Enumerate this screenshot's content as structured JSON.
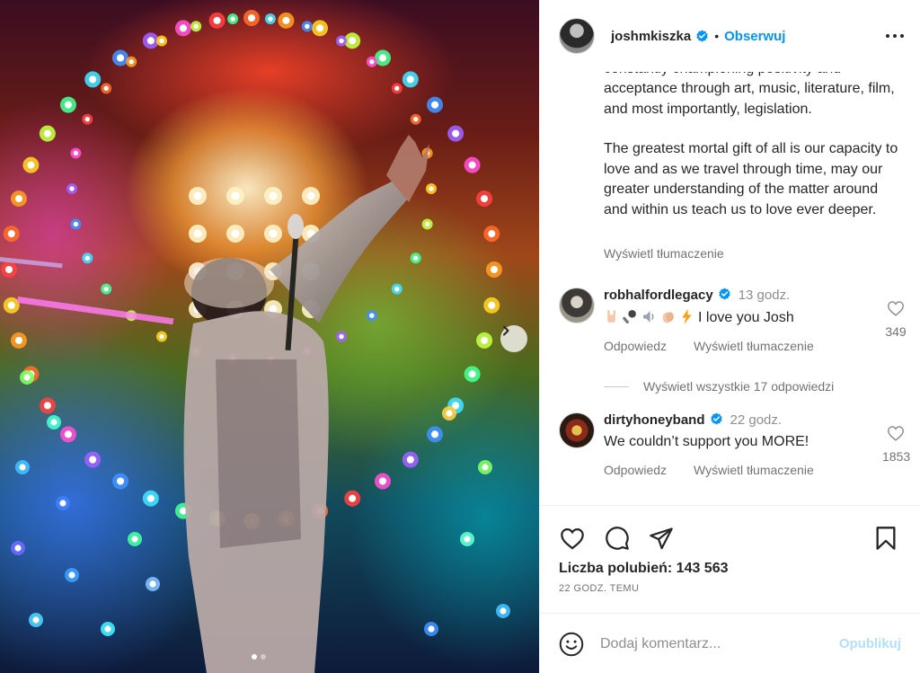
{
  "post": {
    "author": "joshmkiszka",
    "follow_label": "Obserwuj",
    "separator": "•",
    "caption_top_line": "constantly championing positivity and",
    "caption_paragraph_1": "acceptance through art, music, literature, film, and most importantly, legislation.",
    "caption_paragraph_2": "The greatest mortal gift of all is our capacity to love and as we travel through time, may our greater understanding of the matter around and within us teach us to love ever deeper.",
    "see_translation": "Wyświetl tłumaczenie"
  },
  "comments": [
    {
      "username": "robhalfordlegacy",
      "time": "13 godz.",
      "emojis": [
        "horns-hand-emoji",
        "microphone-emoji",
        "speaker-emoji",
        "clapping-hands-emoji",
        "lightning-emoji"
      ],
      "text": "I love you Josh",
      "likes": "349",
      "reply_label": "Odpowiedz",
      "translate_label": "Wyświetl tłumaczenie"
    },
    {
      "username": "dirtyhoneyband",
      "time": "22 godz.",
      "text": "We couldn’t support you MORE!",
      "likes": "1853",
      "reply_label": "Odpowiedz",
      "translate_label": "Wyświetl tłumaczenie"
    }
  ],
  "view_replies": "Wyświetl wszystkie 17 odpowiedzi",
  "engagement": {
    "likes_text": "Liczba polubień: 143 563",
    "posted_ago": "22 GODZ. TEMU"
  },
  "comment_box": {
    "placeholder": "Dodaj komentarz...",
    "publish_label": "Opublikuj"
  },
  "carousel": {
    "slide_count": 2,
    "current_slide": 1
  },
  "colors": {
    "accent": "#0095f6",
    "verified": "#0095f6",
    "muted_text": "#737373",
    "publish_disabled": "#b2dffc"
  },
  "icons": {
    "header": [
      "verified-badge-icon",
      "more-options-icon"
    ],
    "media": [
      "chevron-right-icon"
    ],
    "actions": [
      "heart-icon",
      "comment-icon",
      "share-icon",
      "bookmark-icon"
    ],
    "comment_box": [
      "emoji-smile-icon"
    ]
  }
}
